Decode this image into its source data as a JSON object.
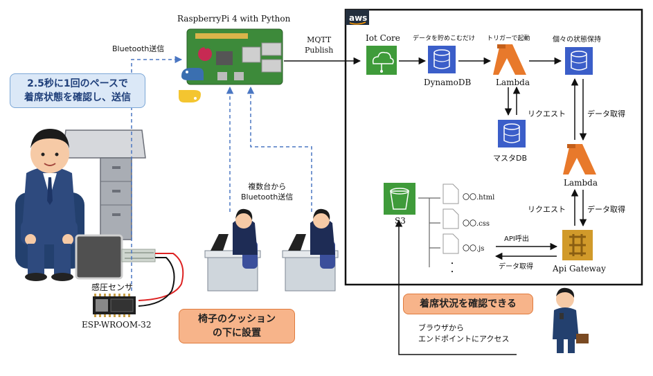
{
  "aws": {
    "badge": "aws"
  },
  "raspberry": {
    "label": "RaspberryPi 4 with Python"
  },
  "bluetooth_send": {
    "label": "Bluetooth送信"
  },
  "multi_bluetooth": {
    "line1": "複数台から",
    "line2": "Bluetooth送信"
  },
  "mqtt": {
    "line1": "MQTT",
    "line2": "Publish"
  },
  "iot_core": {
    "label": "Iot Core"
  },
  "dynamodb": {
    "label": "DynamoDB",
    "caption": "データを貯めこむだけ"
  },
  "lambda_top": {
    "label": "Lambda",
    "caption": "トリガーで起動"
  },
  "state_db": {
    "caption": "個々の状態保持"
  },
  "master_db": {
    "label": "マスタDB"
  },
  "lambda_mid": {
    "label": "Lambda"
  },
  "api_gateway": {
    "label": "Api Gateway"
  },
  "s3": {
    "label": "S3"
  },
  "files": [
    "〇〇.html",
    "〇〇.css",
    "〇〇.js",
    "・",
    "・"
  ],
  "arrows": {
    "request1": "リクエスト",
    "data_get1": "データ取得",
    "request2": "リクエスト",
    "data_get2": "データ取得",
    "api_call": "API呼出",
    "data_get3": "データ取得"
  },
  "sensor": {
    "label": "感圧センサ"
  },
  "esp": {
    "label": "ESP-WROOM-32"
  },
  "callouts": {
    "interval_line1": "2.5秒に1回のペースで",
    "interval_line2": "着席状態を確認し、送信",
    "cushion_line1": "椅子のクッション",
    "cushion_line2": "の下に設置",
    "confirm": "着席状況を確認できる"
  },
  "browser": {
    "line1": "ブラウザから",
    "line2": "エンドポイントにアクセス"
  },
  "colors": {
    "lambda_orange": "#e8792b",
    "dynamo_blue": "#3b5ec9",
    "iot_green": "#3f9b3a",
    "api_gold": "#d19a2a",
    "dashed_blue": "#4a76c2",
    "callout_orange": "#f7b48a",
    "callout_blue": "#dbe8f7"
  }
}
